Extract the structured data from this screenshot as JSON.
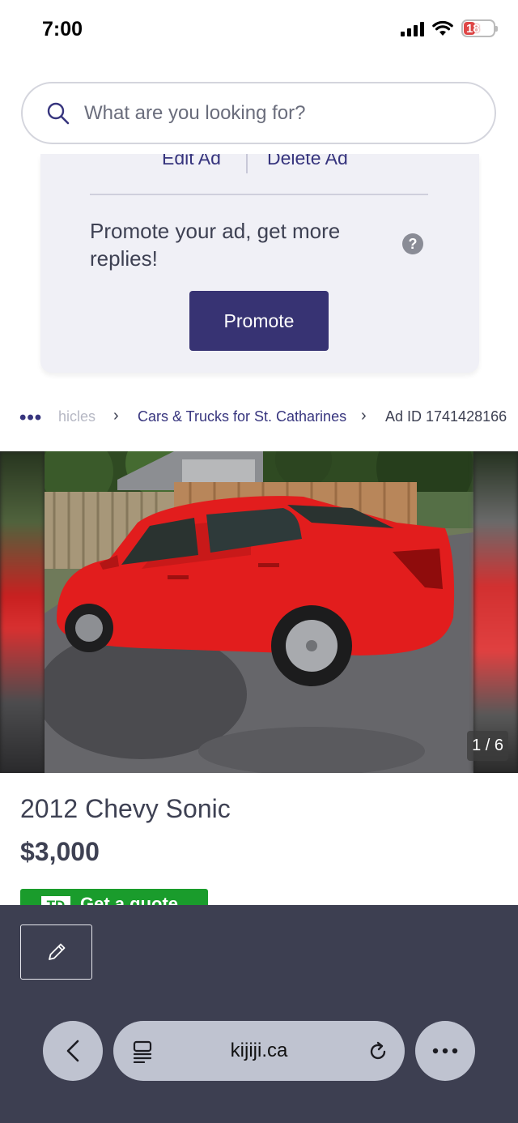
{
  "status_bar": {
    "time": "7:00",
    "battery": "18",
    "icons": [
      "cellular-signal-icon",
      "wifi-icon",
      "battery-charging-icon"
    ]
  },
  "search": {
    "placeholder": "What are you looking for?",
    "value": ""
  },
  "manage_card": {
    "edit_label": "Edit Ad",
    "delete_label": "Delete Ad",
    "promote_text": "Promote your ad, get more replies!",
    "help_glyph": "?",
    "promote_button": "Promote"
  },
  "breadcrumb": {
    "more": "•••",
    "items": [
      "hicles",
      "Cars & Trucks for St. Catharines",
      "Ad ID 1741428166"
    ]
  },
  "gallery": {
    "counter": "1 / 6",
    "current_index": 1,
    "total": 6
  },
  "listing": {
    "title": "2012 Chevy Sonic",
    "price": "$3,000",
    "quote_logo": "TD",
    "quote_button": "Get a quote"
  },
  "browser": {
    "url": "kijiji.ca"
  },
  "colors": {
    "brand_primary": "#373373",
    "link": "#37357e",
    "text": "#3e4153",
    "card_bg": "#f0f0f6",
    "browser_bar": "#3d3f51",
    "td_green": "#1a9c2c",
    "car_red": "#e21d1d"
  }
}
